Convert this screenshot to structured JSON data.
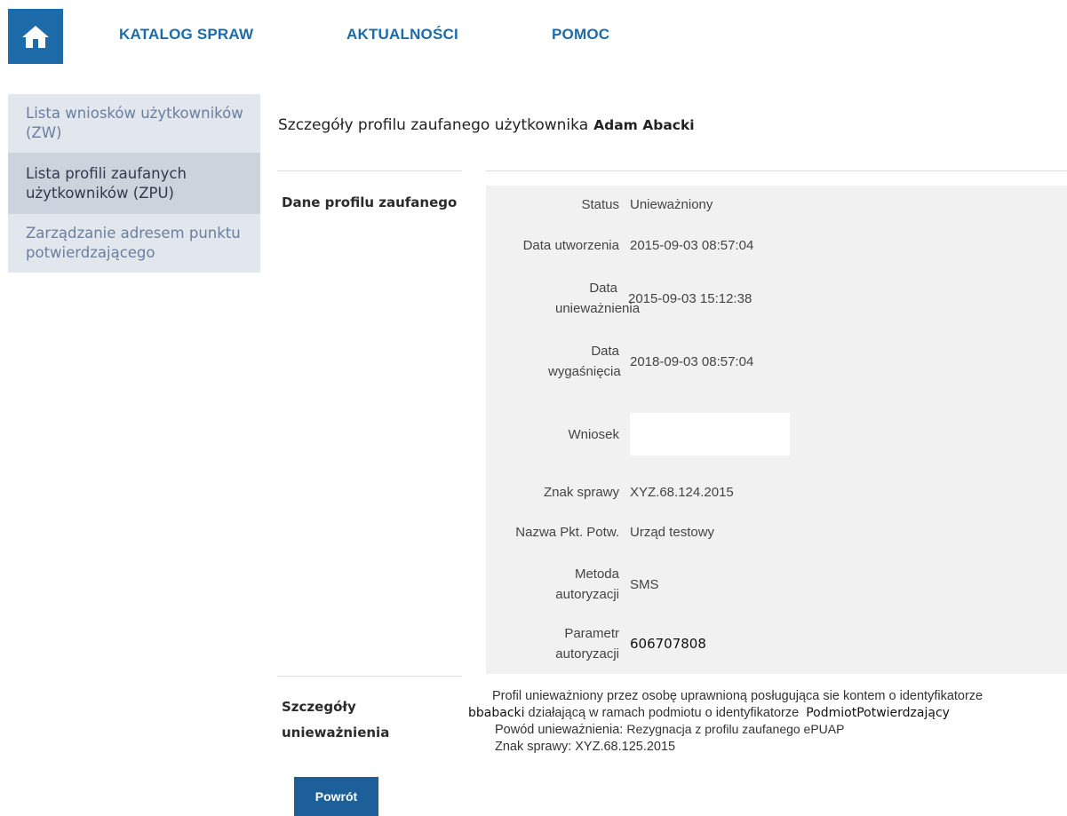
{
  "nav": {
    "home_icon": "home-icon",
    "links": [
      "KATALOG SPRAW",
      "AKTUALNOŚCI",
      "POMOC"
    ]
  },
  "sidebar": {
    "items": [
      {
        "label": "Lista wniosków użytkowników (ZW)"
      },
      {
        "label": "Lista profili zaufanych użytkowników (ZPU)"
      },
      {
        "label": "Zarządzanie adresem punktu potwierdzającego"
      }
    ],
    "active_index": 1
  },
  "page": {
    "title": "Szczegóły profilu zaufanego użytkownika",
    "user_name": "Adam Abacki"
  },
  "profile_section": {
    "label": "Dane profilu zaufanego",
    "fields": [
      {
        "label": "Status",
        "value": "Unieważniony"
      },
      {
        "label": "Data utworzenia",
        "value": "2015-09-03 08:57:04"
      },
      {
        "label": "Data unieważnienia",
        "value": "2015-09-03 15:12:38"
      },
      {
        "label": "Data wygaśnięcia",
        "value": "2018-09-03 08:57:04"
      },
      {
        "label": "Wniosek",
        "value": ""
      },
      {
        "label": "Znak sprawy",
        "value": "XYZ.68.124.2015"
      },
      {
        "label": "Nazwa Pkt. Potw.",
        "value": "Urząd testowy"
      },
      {
        "label": "Metoda autoryzacji",
        "value": "SMS"
      },
      {
        "label": "Parametr autoryzacji",
        "value": "606707808"
      }
    ]
  },
  "invalidation_section": {
    "label": "Szczegóły unieważnienia",
    "line1": "Profil unieważniony przez osobę uprawnioną posługująca sie kontem o identyfikatorze",
    "login": "bbabacki",
    "line2_mid": " działającą w ramach podmiotu o identyfikatorze ",
    "entity_id": "PodmiotPotwierdzający",
    "reason_label": "Powód unieważnienia: ",
    "reason": "Rezygnacja z profilu zaufanego ePUAP",
    "case_label": "Znak sprawy: ",
    "case_number": "XYZ.68.125.2015"
  },
  "actions": {
    "back_label": "Powrót"
  },
  "colors": {
    "brand_blue": "#1d6ba8",
    "sidebar_bg": "#e2e6ed",
    "sidebar_active_bg": "#cdd3dc",
    "details_bg": "#f1f1f1"
  }
}
